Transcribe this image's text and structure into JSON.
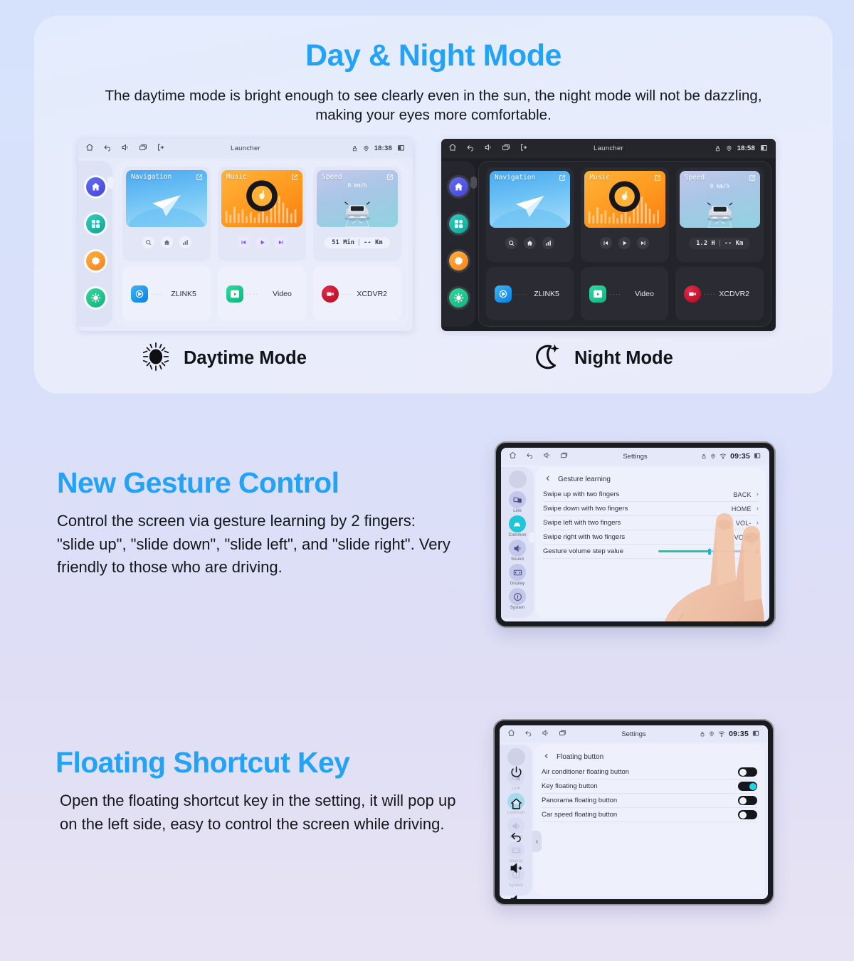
{
  "hero": {
    "title": "Day & Night Mode",
    "subtitle": "The daytime mode is bright enough to see clearly even in the sun, the night mode will not be dazzling, making your eyes more comfortable."
  },
  "day_unit": {
    "status": {
      "title": "Launcher",
      "time": "18:38"
    },
    "rail": [
      {
        "name": "home",
        "color": "#4a5fe0"
      },
      {
        "name": "apps",
        "color": "#19b6a6"
      },
      {
        "name": "settings",
        "color": "#f79520"
      },
      {
        "name": "brightness",
        "color": "#1fc48a"
      }
    ],
    "widgets": [
      {
        "label": "Navigation",
        "controls": [
          "search",
          "home",
          "chart"
        ]
      },
      {
        "label": "Music",
        "controls": [
          "prev",
          "play",
          "next"
        ]
      },
      {
        "label": "Speed",
        "speed_value": "0 km/h",
        "eta_time": "51 Min",
        "eta_dist": "-- Km"
      }
    ],
    "apps": [
      {
        "name": "ZLINK5",
        "dots": "····",
        "color": "#1a95ef",
        "icon": "play-circle"
      },
      {
        "name": "Video",
        "dots": "····",
        "color": "#1cc38c",
        "icon": "video-player"
      },
      {
        "name": "XCDVR2",
        "dots": "····",
        "color": "#c40c2e",
        "icon": "camcorder"
      }
    ]
  },
  "night_unit": {
    "status": {
      "title": "Launcher",
      "time": "18:58"
    },
    "rail": [
      {
        "name": "home",
        "color": "#4a5fe0"
      },
      {
        "name": "apps",
        "color": "#19b6a6"
      },
      {
        "name": "settings",
        "color": "#f79520"
      },
      {
        "name": "brightness",
        "color": "#1fc48a"
      }
    ],
    "widgets": [
      {
        "label": "Navigation",
        "controls": [
          "search",
          "home",
          "chart"
        ]
      },
      {
        "label": "Music",
        "controls": [
          "prev",
          "play",
          "next"
        ]
      },
      {
        "label": "Speed",
        "speed_value": "0 km/h",
        "eta_time": "1.2 H",
        "eta_dist": "-- Km"
      }
    ],
    "apps": [
      {
        "name": "ZLINK5",
        "dots": "····",
        "color": "#1a95ef",
        "icon": "play-circle"
      },
      {
        "name": "Video",
        "dots": "····",
        "color": "#1cc38c",
        "icon": "video-player"
      },
      {
        "name": "XCDVR2",
        "dots": "····",
        "color": "#c40c2e",
        "icon": "camcorder"
      }
    ]
  },
  "captions": {
    "day": "Daytime Mode",
    "night": "Night Mode"
  },
  "gesture_feature": {
    "title": "New Gesture Control",
    "body": "Control the screen via gesture learning by 2 fingers: \"slide up\", \"slide down\", \"slide left\", and \"slide right\". Very friendly to those who are driving."
  },
  "gesture_tablet": {
    "status": {
      "title": "Settings",
      "time": "09:35"
    },
    "rail": [
      {
        "label": "Link",
        "icon": "link-icon",
        "active": false
      },
      {
        "label": "Common",
        "icon": "car-icon",
        "active": true
      },
      {
        "label": "Sound",
        "icon": "speaker-icon",
        "active": false
      },
      {
        "label": "Display",
        "icon": "display-icon",
        "active": false
      },
      {
        "label": "System",
        "icon": "info-icon",
        "active": false
      }
    ],
    "page_title": "Gesture learning",
    "rows": [
      {
        "label": "Swipe up with two fingers",
        "value": "BACK"
      },
      {
        "label": "Swipe down with two fingers",
        "value": "HOME"
      },
      {
        "label": "Swipe left with two fingers",
        "value": "VOL-"
      },
      {
        "label": "Swipe right with two fingers",
        "value": "VOL+"
      }
    ],
    "slider_row": {
      "label": "Gesture volume step value",
      "value": "3"
    }
  },
  "floating_feature": {
    "title": "Floating Shortcut Key",
    "body": "Open the floating shortcut key in the setting, it will pop up on the left side, easy to control the screen while driving."
  },
  "floating_tablet": {
    "status": {
      "title": "Settings",
      "time": "09:35"
    },
    "rail": [
      {
        "label": "Link",
        "icon": "link-icon",
        "active": false
      },
      {
        "label": "Common",
        "icon": "car-icon",
        "active": true
      },
      {
        "label": "Sound",
        "icon": "speaker-icon",
        "active": false
      },
      {
        "label": "Display",
        "icon": "display-icon",
        "active": false
      },
      {
        "label": "System",
        "icon": "info-icon",
        "active": false
      }
    ],
    "page_title": "Floating button",
    "rows": [
      {
        "label": "Air conditioner floating button",
        "on": false
      },
      {
        "label": "Key floating button",
        "on": true
      },
      {
        "label": "Panorama floating button",
        "on": false
      },
      {
        "label": "Car speed floating button",
        "on": false
      }
    ],
    "overlay_icons": [
      "power-icon",
      "home-icon",
      "back-icon",
      "volume-up-icon",
      "volume-down-icon"
    ]
  },
  "colors": {
    "accent": "#23a3f5",
    "toggle_on": "#23d3e8",
    "slider_fill": "#17c9a6"
  }
}
